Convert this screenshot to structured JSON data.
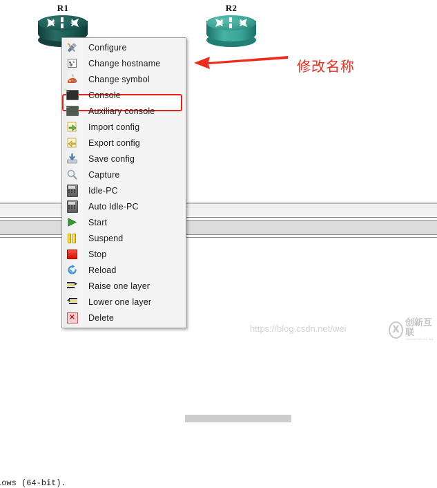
{
  "app": {
    "background_color": "#ffffff",
    "console_text": "lows (64-bit)."
  },
  "topology": {
    "nodes": [
      {
        "label": "R1",
        "icon": "router-icon",
        "color": "#1e5e58",
        "state": "selected"
      },
      {
        "label": "R2",
        "icon": "router-icon",
        "color": "#39a093",
        "state": "normal"
      }
    ]
  },
  "annotation": {
    "arrow_icon": "left-arrow-annotation-icon",
    "text": "修改名称",
    "color": "#ef2b1d"
  },
  "context_menu": {
    "highlight_color": "#e8211a",
    "highlighted_item": "Change hostname",
    "items": [
      {
        "label": "Configure",
        "icon": "wrench-screwdriver-icon"
      },
      {
        "label": "Change hostname",
        "icon": "rename-abc-icon"
      },
      {
        "label": "Change symbol",
        "icon": "palette-brush-icon"
      },
      {
        "label": "Console",
        "icon": "terminal-icon"
      },
      {
        "label": "Auxiliary console",
        "icon": "aux-terminal-icon"
      },
      {
        "label": "Import config",
        "icon": "import-arrow-icon"
      },
      {
        "label": "Export config",
        "icon": "export-arrow-icon"
      },
      {
        "label": "Save config",
        "icon": "save-disk-icon"
      },
      {
        "label": "Capture",
        "icon": "magnifier-icon"
      },
      {
        "label": "Idle-PC",
        "icon": "calculator-icon"
      },
      {
        "label": "Auto Idle-PC",
        "icon": "calculator-icon"
      },
      {
        "label": "Start",
        "icon": "play-icon"
      },
      {
        "label": "Suspend",
        "icon": "pause-icon"
      },
      {
        "label": "Stop",
        "icon": "stop-icon"
      },
      {
        "label": "Reload",
        "icon": "reload-icon"
      },
      {
        "label": "Raise one layer",
        "icon": "raise-layer-icon"
      },
      {
        "label": "Lower one layer",
        "icon": "lower-layer-icon"
      },
      {
        "label": "Delete",
        "icon": "delete-icon"
      }
    ]
  },
  "watermark": {
    "url": "https://blog.csdn.net/wei",
    "logo_text": "创新互联",
    "logo_subtext": "CHUANGXIN HULIAN",
    "logo_mark": "X"
  }
}
